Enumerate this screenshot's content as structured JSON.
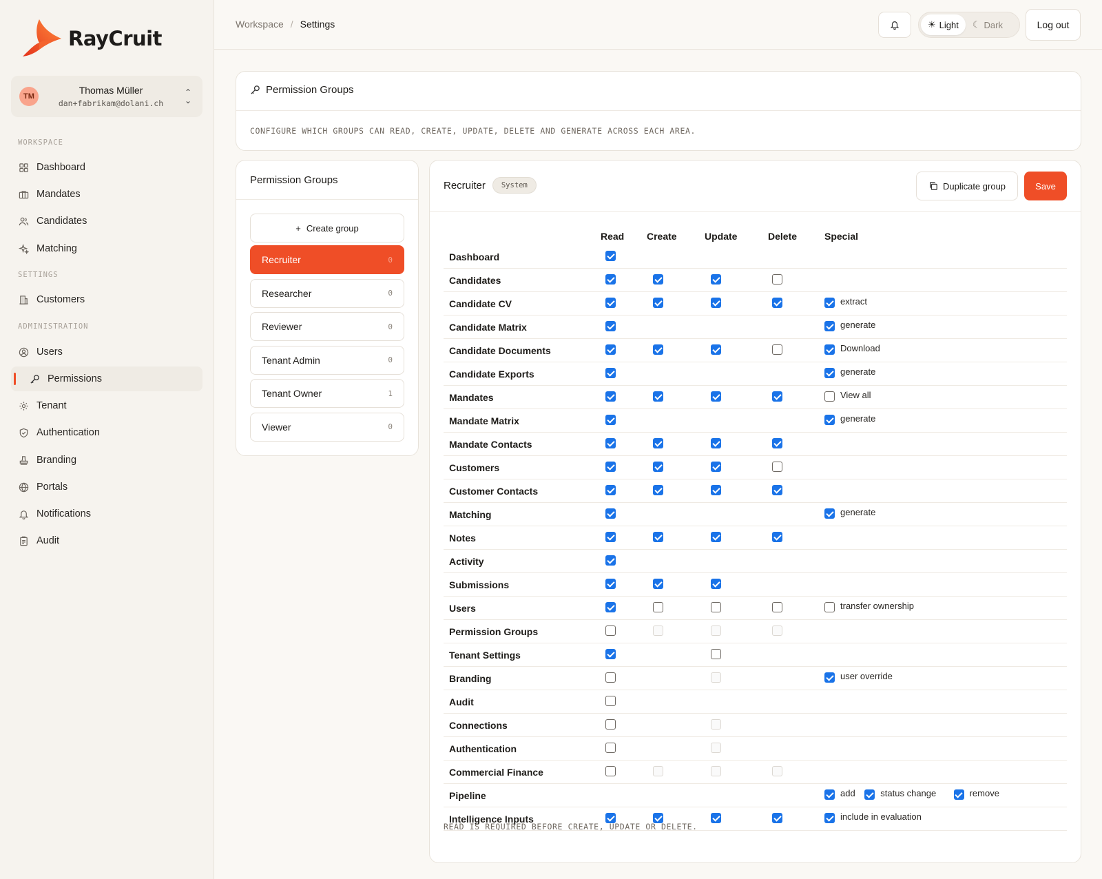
{
  "brand": {
    "name": "RayCruit"
  },
  "user": {
    "initials": "TM",
    "name": "Thomas Müller",
    "email": "dan+fabrikam@dolani.ch"
  },
  "sidebar": {
    "sections": {
      "workspace": "WORKSPACE",
      "settings": "SETTINGS",
      "administration": "ADMINISTRATION"
    },
    "items": [
      {
        "label": "Dashboard",
        "icon": "grid-icon"
      },
      {
        "label": "Mandates",
        "icon": "briefcase-icon"
      },
      {
        "label": "Candidates",
        "icon": "users-icon"
      },
      {
        "label": "Matching",
        "icon": "sparkle-icon"
      },
      {
        "label": "Customers",
        "icon": "building-icon"
      },
      {
        "label": "Users",
        "icon": "user-circle-icon"
      },
      {
        "label": "Permissions",
        "icon": "key-icon",
        "active": true
      },
      {
        "label": "Tenant",
        "icon": "gear-icon"
      },
      {
        "label": "Authentication",
        "icon": "shield-icon"
      },
      {
        "label": "Branding",
        "icon": "stamp-icon"
      },
      {
        "label": "Portals",
        "icon": "globe-icon"
      },
      {
        "label": "Notifications",
        "icon": "bell-icon"
      },
      {
        "label": "Audit",
        "icon": "clipboard-icon"
      }
    ]
  },
  "topbar": {
    "crumbs": [
      "Workspace",
      "Settings"
    ],
    "theme": {
      "light": "Light",
      "dark": "Dark",
      "selected": "Light"
    },
    "logout": "Log out"
  },
  "header_panel": {
    "title": "Permission Groups",
    "description": "CONFIGURE WHICH GROUPS CAN READ, CREATE, UPDATE, DELETE AND GENERATE ACROSS EACH AREA."
  },
  "groups_panel": {
    "title": "Permission Groups",
    "create_label": "Create group",
    "groups": [
      {
        "name": "Recruiter",
        "count": "0",
        "selected": true
      },
      {
        "name": "Researcher",
        "count": "0"
      },
      {
        "name": "Reviewer",
        "count": "0"
      },
      {
        "name": "Tenant Admin",
        "count": "0"
      },
      {
        "name": "Tenant Owner",
        "count": "1"
      },
      {
        "name": "Viewer",
        "count": "0"
      }
    ]
  },
  "matrix": {
    "group_name": "Recruiter",
    "badge": "System",
    "duplicate_label": "Duplicate group",
    "save_label": "Save",
    "columns": [
      "Read",
      "Create",
      "Update",
      "Delete",
      "Special"
    ],
    "footnote": "READ IS REQUIRED BEFORE CREATE, UPDATE OR DELETE.",
    "rows": [
      {
        "label": "Dashboard",
        "read": "on",
        "create": null,
        "update": null,
        "delete": null,
        "special": []
      },
      {
        "label": "Candidates",
        "read": "on",
        "create": "on",
        "update": "on",
        "delete": "off",
        "special": []
      },
      {
        "label": "Candidate CV",
        "read": "on",
        "create": "on",
        "update": "on",
        "delete": "on",
        "special": [
          {
            "label": "extract",
            "state": "on"
          }
        ]
      },
      {
        "label": "Candidate Matrix",
        "read": "on",
        "create": null,
        "update": null,
        "delete": null,
        "special": [
          {
            "label": "generate",
            "state": "on"
          }
        ]
      },
      {
        "label": "Candidate Documents",
        "read": "on",
        "create": "on",
        "update": "on",
        "delete": "off",
        "special": [
          {
            "label": "Download",
            "state": "on"
          }
        ]
      },
      {
        "label": "Candidate Exports",
        "read": "on",
        "create": null,
        "update": null,
        "delete": null,
        "special": [
          {
            "label": "generate",
            "state": "on"
          }
        ]
      },
      {
        "label": "Mandates",
        "read": "on",
        "create": "on",
        "update": "on",
        "delete": "on",
        "special": [
          {
            "label": "View all",
            "state": "off"
          }
        ]
      },
      {
        "label": "Mandate Matrix",
        "read": "on",
        "create": null,
        "update": null,
        "delete": null,
        "special": [
          {
            "label": "generate",
            "state": "on"
          }
        ]
      },
      {
        "label": "Mandate Contacts",
        "read": "on",
        "create": "on",
        "update": "on",
        "delete": "on",
        "special": []
      },
      {
        "label": "Customers",
        "read": "on",
        "create": "on",
        "update": "on",
        "delete": "off",
        "special": []
      },
      {
        "label": "Customer Contacts",
        "read": "on",
        "create": "on",
        "update": "on",
        "delete": "on",
        "special": []
      },
      {
        "label": "Matching",
        "read": "on",
        "create": null,
        "update": null,
        "delete": null,
        "special": [
          {
            "label": "generate",
            "state": "on"
          }
        ]
      },
      {
        "label": "Notes",
        "read": "on",
        "create": "on",
        "update": "on",
        "delete": "on",
        "special": []
      },
      {
        "label": "Activity",
        "read": "on",
        "create": null,
        "update": null,
        "delete": null,
        "special": []
      },
      {
        "label": "Submissions",
        "read": "on",
        "create": "on",
        "update": "on",
        "delete": null,
        "special": []
      },
      {
        "label": "Users",
        "read": "on",
        "create": "off",
        "update": "off",
        "delete": "off",
        "special": [
          {
            "label": "transfer ownership",
            "state": "off"
          }
        ]
      },
      {
        "label": "Permission Groups",
        "read": "off",
        "create": "dis",
        "update": "dis",
        "delete": "dis",
        "special": []
      },
      {
        "label": "Tenant Settings",
        "read": "on",
        "create": null,
        "update": "off",
        "delete": null,
        "special": []
      },
      {
        "label": "Branding",
        "read": "off",
        "create": null,
        "update": "dis",
        "delete": null,
        "special": [
          {
            "label": "user override",
            "state": "on"
          }
        ]
      },
      {
        "label": "Audit",
        "read": "off",
        "create": null,
        "update": null,
        "delete": null,
        "special": []
      },
      {
        "label": "Connections",
        "read": "off",
        "create": null,
        "update": "dis",
        "delete": null,
        "special": []
      },
      {
        "label": "Authentication",
        "read": "off",
        "create": null,
        "update": "dis",
        "delete": null,
        "special": []
      },
      {
        "label": "Commercial Finance",
        "read": "off",
        "create": "dis",
        "update": "dis",
        "delete": "dis",
        "special": []
      },
      {
        "label": "Pipeline",
        "read": null,
        "create": null,
        "update": null,
        "delete": null,
        "special": [
          {
            "label": "add",
            "state": "on"
          },
          {
            "label": "status change",
            "state": "on"
          },
          {
            "label": "remove",
            "state": "on"
          }
        ]
      },
      {
        "label": "Intelligence Inputs",
        "read": "on",
        "create": "on",
        "update": "on",
        "delete": "on",
        "special": [
          {
            "label": "include in evaluation",
            "state": "on"
          }
        ]
      }
    ]
  }
}
